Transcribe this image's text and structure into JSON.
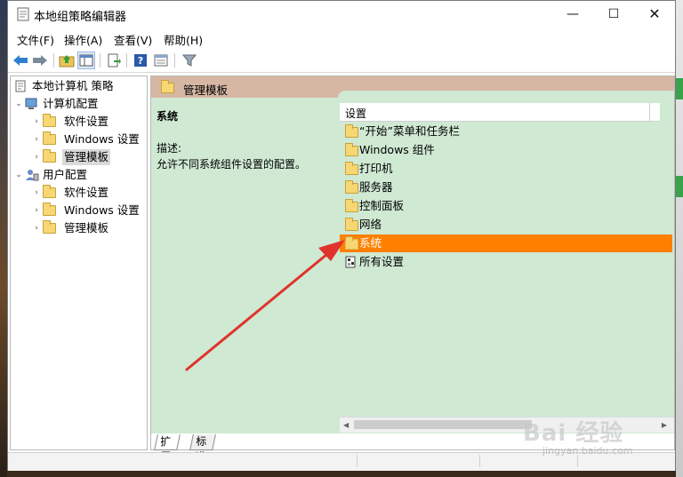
{
  "window": {
    "title": "本地组策略编辑器",
    "buttons": {
      "minimize": "—",
      "maximize": "☐",
      "close": "✕"
    }
  },
  "menu": [
    "文件(F)",
    "操作(A)",
    "查看(V)",
    "帮助(H)"
  ],
  "toolbar": {
    "icons": [
      "back-arrow-icon",
      "forward-arrow-icon",
      "up-folder-icon",
      "show-hide-tree-icon",
      "export-list-icon",
      "help-icon",
      "properties-icon",
      "filter-icon"
    ]
  },
  "tree": {
    "root": "本地计算机 策略",
    "computer": {
      "label": "计算机配置",
      "children": [
        "软件设置",
        "Windows 设置",
        "管理模板"
      ]
    },
    "user": {
      "label": "用户配置",
      "children": [
        "软件设置",
        "Windows 设置",
        "管理模板"
      ]
    }
  },
  "panel": {
    "header": "管理模板",
    "desc_title": "系统",
    "desc_label": "描述:",
    "desc_text": "允许不同系统组件设置的配置。",
    "column": "设置",
    "items": [
      "“开始”菜单和任务栏",
      "Windows 组件",
      "打印机",
      "服务器",
      "控制面板",
      "网络",
      "系统",
      "所有设置"
    ],
    "selected": "系统"
  },
  "tabs": [
    "扩展",
    "标准"
  ],
  "colors": {
    "header_band": "#d6b7a3",
    "panel_bg": "#cfe9d3",
    "selected_row": "#ff8000",
    "arrow": "#e0332c"
  },
  "watermark": {
    "brand": "Bai 经验",
    "url": "jingyan.baidu.com"
  }
}
